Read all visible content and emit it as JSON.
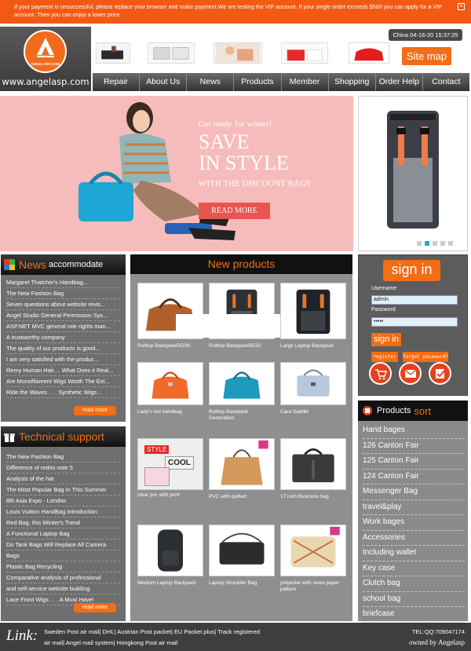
{
  "notice": {
    "text": "If your payment is unsuccessful, please replace your browser and make payment.We are testing the VIP account. If your single order exceeds $500 you can apply for a VIP account. Then you can enjoy a lower price",
    "close": "×"
  },
  "logo": {
    "brand": "ANGELASP.COM",
    "url": "www.angelasp.com"
  },
  "header": {
    "datetime": "China 04-16-20 15:37:25",
    "sitemap": "Site map"
  },
  "nav": [
    "Repair",
    "About Us",
    "News",
    "Products",
    "Member",
    "Shopping",
    "Order Help",
    "Contact"
  ],
  "hero": {
    "line1": "Get ready for winter!",
    "line2": "SAVE",
    "line3": "IN STYLE",
    "line4": "WITH THE DISCOUNT BAGS",
    "button": "READ MORE"
  },
  "news": {
    "title_main": "News",
    "title_sub": "accommodate",
    "items": [
      "Margaret Thatcher's Handbag...",
      "The New Fashion Bag",
      "Seven questions about website revis...",
      "Angel Studio General Permission Sys...",
      "ASP.NET MVC general role rights man...",
      "A trustworthy company",
      "The quality of our products is good...",
      "I am very satisfied with the produc...",
      "Remy Human Hair.... What Does it Real...",
      "Are Monofilament Wigs Worth The Ext...",
      "Ride the Waves . . . Synthetic Wigs..."
    ],
    "readmore": "read more"
  },
  "support": {
    "title": "Technical support",
    "items": [
      "The New Fashion Bag",
      "Difference of redmi note 5",
      "Analysis of the hat",
      "The Most Popular Bag In This Summer",
      "8th Asia Expo - London",
      "Louis Vuitton HandBag Introduction",
      "Red Bag, this Winter's Trend",
      "A Functional Laptop Bag",
      "Do Tank Bags Will Replace All Camera",
      "Bags",
      "Plastic Bag Recycling",
      "Comparative analysis of professional",
      "and self-service website building",
      "Lace Front Wigs . . . A Must Have!"
    ],
    "readmore": "read more"
  },
  "products": {
    "title": "New products",
    "items": [
      "Rolltop BackpackRD39",
      "Rolltop BackpackRD32",
      "Large Laptop Backpack",
      "Lady's red handbag",
      "Rolltop Backpack Generation",
      "Cara Saddle",
      "clear pvc with print",
      "PVC with quilted",
      "17 inch Business bag",
      "Medium Laptop Backpack",
      "Laptop Shoulder Bag",
      "polyester with news paper pattern"
    ],
    "cool_text": "COOL",
    "style_text": "STYLE"
  },
  "signin": {
    "title": "sign in",
    "username_label": "Username",
    "username_value": "admin",
    "password_label": "Password",
    "password_value": "•••••",
    "submit": "sign in",
    "register": "register",
    "forgot": "forgot password?"
  },
  "sort": {
    "title_main": "Products",
    "title_sub": "sort",
    "items": [
      "Hand bages",
      "126 Canton Fair",
      "125 Canton Fair",
      "124 Canton Fair",
      "Messenger Bag",
      "travel&play",
      "Work bages",
      "Accessories",
      "Including wallet",
      "Key case",
      "Clutch bag",
      "school bag",
      "briefcase"
    ]
  },
  "footer": {
    "link_word": "Link:",
    "line1": "Sweden Post air mail| DHL| Austrian Post packet| EU Packet plus| Track registered",
    "line2": "air mail| Angel mail system| Hongkong Post air mail",
    "tel": "TEL:QQ:709047174",
    "owned": "owned by Angelasp"
  },
  "colors": {
    "accent": "#f36d14",
    "notice_bg": "#f25a14",
    "hero_bg": "#f6bcbb",
    "panel_bg": "#6e6e6e"
  }
}
